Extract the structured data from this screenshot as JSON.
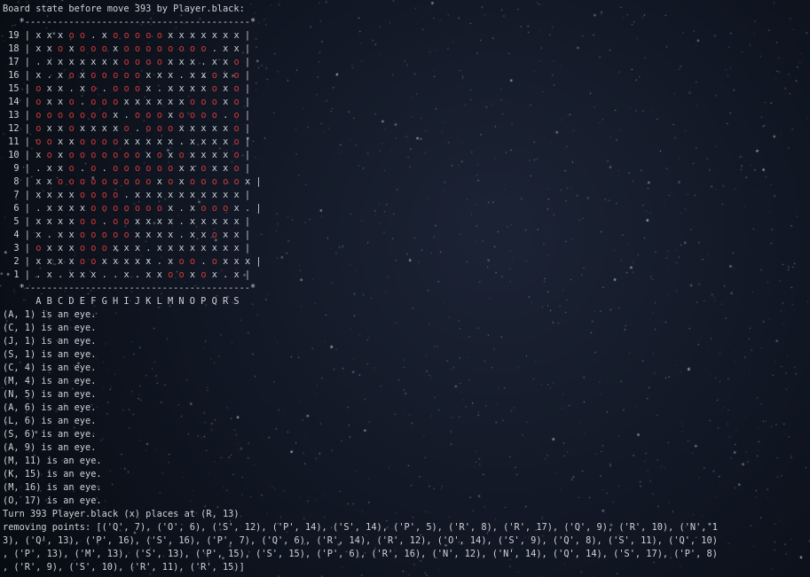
{
  "board_header": "Board state before move 393 by Player.black:",
  "border_top": "   *-----------------------------------------*",
  "border_bottom": "   *-----------------------------------------*",
  "column_labels": "      A B C D E F G H I J K L M N O P Q R S",
  "board_rows": [
    {
      "num": "19",
      "cells": "xxxoo.xoooooxxxxxxx"
    },
    {
      "num": "18",
      "cells": "xxoxoooxoooooooo.xx"
    },
    {
      "num": "17",
      "cells": ".xxxxxxxooooxxx.xxo"
    },
    {
      "num": "16",
      "cells": "x.xoxoooooxxx.xxoxo"
    },
    {
      "num": "15",
      "cells": "oxx.xo.ooox.xxxxoxo"
    },
    {
      "num": "14",
      "cells": "oxxo.oooxxxxxxoooxo"
    },
    {
      "num": "13",
      "cells": "ooooooox.oooxoooo.o"
    },
    {
      "num": "12",
      "cells": "oxxoxxxxo.oooxxxxxo"
    },
    {
      "num": "11",
      "cells": "ooxxooooxxxxx.xxxxo"
    },
    {
      "num": "10",
      "cells": "xoxoooooooxoxoxxxxo"
    },
    {
      "num": "9",
      "cells": ".xxo.o.ooooooxxoxxo"
    },
    {
      "num": "8",
      "cells": "xxoooooooooxoxooooox"
    },
    {
      "num": "7",
      "cells": "xxxxoooo.xxxxxxxxxx"
    },
    {
      "num": "6",
      "cells": ".xxxxooooooox.xooox."
    },
    {
      "num": "5",
      "cells": "xxxxoo.ooxxxx.xxxxx"
    },
    {
      "num": "4",
      "cells": "x.xxoooooxxxx.xxoxx"
    },
    {
      "num": "3",
      "cells": "oxxxoooxxx.xxxxxxxx"
    },
    {
      "num": "2",
      "cells": "xxxxooxxxxx.xoo.oxxx"
    },
    {
      "num": "1",
      "cells": ".x.xxx..x.xxooxox.x"
    }
  ],
  "eye_lines": [
    "(A, 1) is an eye.",
    "(C, 1) is an eye.",
    "(J, 1) is an eye.",
    "(S, 1) is an eye.",
    "(C, 4) is an eye.",
    "(M, 4) is an eye.",
    "(N, 5) is an eye.",
    "(A, 6) is an eye.",
    "(L, 6) is an eye.",
    "(S, 6) is an eye.",
    "(A, 9) is an eye.",
    "(M, 11) is an eye.",
    "(K, 15) is an eye.",
    "(M, 16) is an eye.",
    "(O, 17) is an eye."
  ],
  "turn_line": "Turn 393 Player.black (x) places at (R, 13)",
  "removing_lines": [
    "removing points: [('Q', 7), ('O', 6), ('S', 12), ('P', 14), ('S', 14), ('P', 5), ('R', 8), ('R', 17), ('Q', 9), ('R', 10), ('N', 1",
    "3), ('Q', 13), ('P', 16), ('S', 16), ('P', 7), ('Q', 6), ('R', 14), ('R', 12), ('O', 14), ('S', 9), ('Q', 8), ('S', 11), ('Q', 10)",
    ", ('P', 13), ('M', 13), ('S', 13), ('P', 15), ('S', 15), ('P', 6), ('R', 16), ('N', 12), ('N', 14), ('Q', 14), ('S', 17), ('P', 8)",
    ", ('R', 9), ('S', 10), ('R', 11), ('R', 15)]"
  ],
  "colors": {
    "background": "#0a0e16",
    "text": "#cfd2d8",
    "stone_white_o": "#d13a3a",
    "stone_black_x": "#cdd0d6"
  }
}
